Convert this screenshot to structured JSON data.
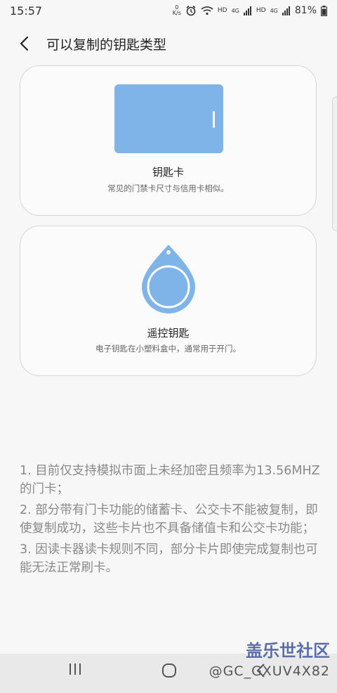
{
  "status": {
    "time": "15:57",
    "speed_top": "0",
    "speed_bottom": "K/s",
    "hd1": "HD",
    "lte1": "4G",
    "hd2": "HD",
    "lte2": "4G",
    "battery": "81%"
  },
  "header": {
    "title": "可以复制的钥匙类型"
  },
  "cards": [
    {
      "title": "钥匙卡",
      "desc": "常见的门禁卡尺寸与信用卡相似。"
    },
    {
      "title": "遥控钥匙",
      "desc": "电子钥匙在小塑料盒中，通常用于开门。"
    }
  ],
  "notes": [
    "1. 目前仅支持模拟市面上未经加密且频率为13.56MHZ的门卡；",
    "2. 部分带有门卡功能的储蓄卡、公交卡不能被复制，即使复制成功，这些卡片也不具备储值卡和公交卡功能；",
    "3. 因读卡器读卡规则不同，部分卡片即使完成复制也可能无法正常刷卡。"
  ],
  "watermark": {
    "site": "盖乐世社区",
    "user": "@GC_GXUV4X82"
  },
  "colors": {
    "accent": "#7fb4e8",
    "background": "#f7f7f7"
  }
}
